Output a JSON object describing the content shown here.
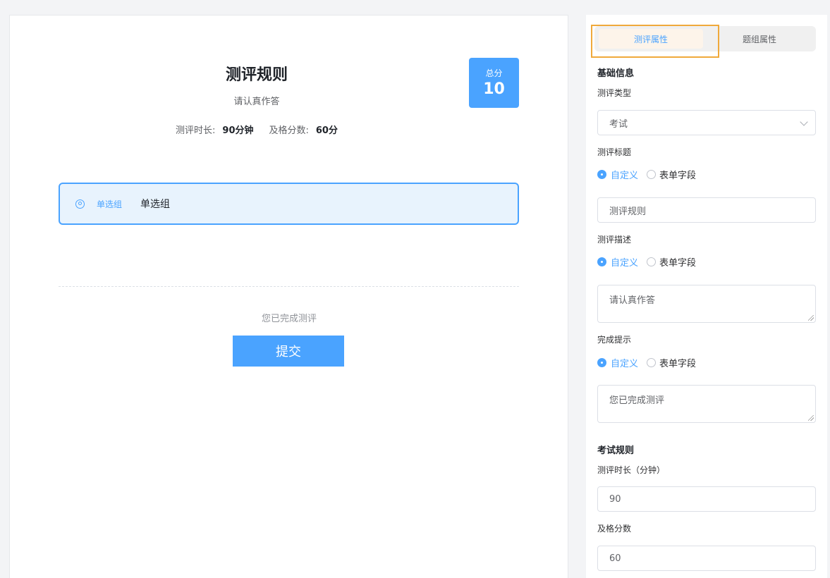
{
  "preview": {
    "title": "测评规则",
    "subtitle": "请认真作答",
    "duration_label": "测评时长:",
    "duration_value": "90分钟",
    "pass_label": "及格分数:",
    "pass_value": "60分",
    "score_label": "总分",
    "score_value": "10",
    "group_tag": "单选组",
    "group_name": "单选组",
    "complete_text": "您已完成测评",
    "submit_label": "提交"
  },
  "panel": {
    "tabs": [
      {
        "label": "测评属性",
        "active": true
      },
      {
        "label": "题组属性",
        "active": false
      }
    ],
    "basic_info_title": "基础信息",
    "type_label": "测评类型",
    "type_value": "考试",
    "title_label": "测评标题",
    "title_options": [
      "自定义",
      "表单字段"
    ],
    "title_value": "测评规则",
    "desc_label": "测评描述",
    "desc_options": [
      "自定义",
      "表单字段"
    ],
    "desc_value": "请认真作答",
    "complete_label": "完成提示",
    "complete_options": [
      "自定义",
      "表单字段"
    ],
    "complete_value": "您已完成测评",
    "exam_rules_title": "考试规则",
    "duration_label": "测评时长（分钟）",
    "duration_value": "90",
    "pass_label": "及格分数",
    "pass_value": "60"
  },
  "colors": {
    "accent": "#4aa3ff",
    "highlight": "#f0a93b",
    "card_bg": "#e8f3fd"
  }
}
